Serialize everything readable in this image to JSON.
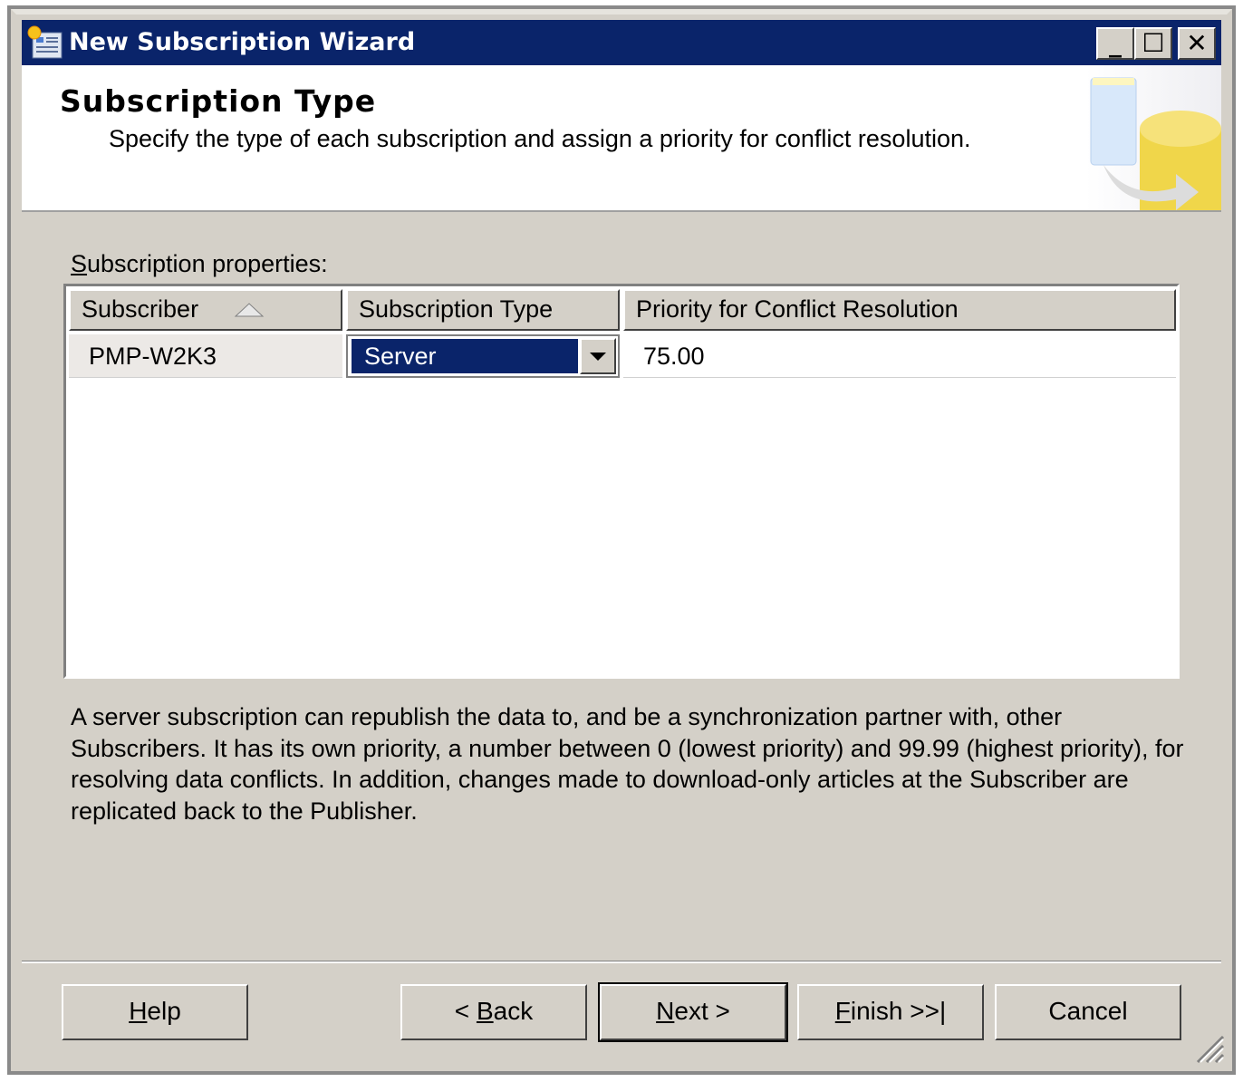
{
  "window": {
    "title": "New Subscription Wizard",
    "minimize": "_",
    "maximize": "☐",
    "close": "✕"
  },
  "header": {
    "title": "Subscription Type",
    "subtitle": "Specify the type of each subscription and assign a priority for conflict resolution."
  },
  "properties_label": {
    "pre": "",
    "accel": "S",
    "post": "ubscription properties:"
  },
  "grid": {
    "columns": [
      "Subscriber",
      "Subscription Type",
      "Priority for Conflict Resolution"
    ],
    "sort_column": "Subscriber",
    "sort_direction": "ascending",
    "rows": [
      {
        "subscriber": "PMP-W2K3",
        "type": "Server",
        "priority": "75.00"
      }
    ]
  },
  "description": "A server subscription can republish the data to, and be a synchronization partner with, other Subscribers. It has its own priority, a number between 0 (lowest priority) and 99.99 (highest priority), for resolving data conflicts. In addition, changes made to download-only articles at the Subscriber are replicated back to the Publisher.",
  "buttons": {
    "help": {
      "accel": "H",
      "rest": "elp"
    },
    "back": {
      "pre": "< ",
      "accel": "B",
      "rest": "ack"
    },
    "next": {
      "accel": "N",
      "rest": "ext >"
    },
    "finish": {
      "accel": "F",
      "rest": "inish >>|"
    },
    "cancel": "Cancel"
  },
  "colors": {
    "titlebar": "#0a246a",
    "face": "#d4d0c8",
    "selection": "#0a246a"
  }
}
